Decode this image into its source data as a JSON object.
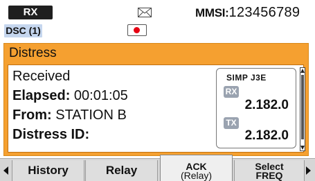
{
  "status": {
    "rx_label": "RX",
    "mmsi_label": "MMSI:",
    "mmsi_value": "123456789"
  },
  "status2": {
    "dsc_label": "DSC (1)"
  },
  "window": {
    "title": "Distress",
    "lines": {
      "received": "Received",
      "elapsed_label": "Elapsed:",
      "elapsed_value": "00:01:05",
      "from_label": "From:",
      "from_value": "STATION B",
      "distress_id_label": "Distress ID:"
    },
    "freq": {
      "mode": "SIMP J3E",
      "rx_tag": "RX",
      "rx_value": "2.182.0",
      "tx_tag": "TX",
      "tx_value": "2.182.0"
    }
  },
  "softkeys": {
    "history": "History",
    "relay": "Relay",
    "ack_line1": "ACK",
    "ack_line2": "(Relay)",
    "select_line1": "Select",
    "select_line2": "FREQ"
  },
  "colors": {
    "window_accent": "#f5a030",
    "dsc_badge": "#c5d6ee",
    "record": "#e60012"
  },
  "icons": {
    "mail": "envelope-icon",
    "record": "record-icon"
  }
}
